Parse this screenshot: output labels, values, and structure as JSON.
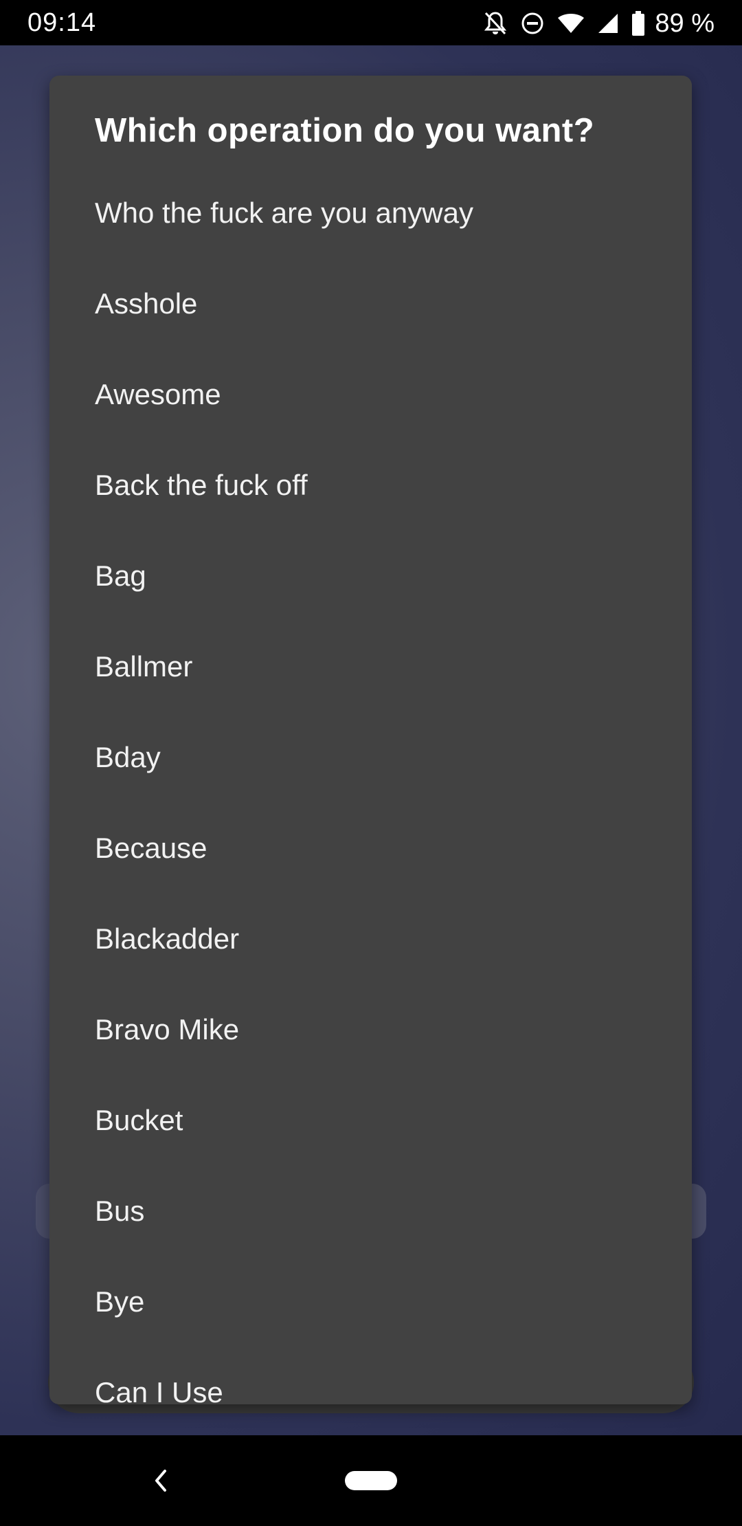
{
  "status_bar": {
    "time": "09:14",
    "battery_percent": "89 %",
    "icons": [
      "notifications-off-icon",
      "do-not-disturb-icon",
      "wifi-icon",
      "cell-signal-icon",
      "battery-icon"
    ]
  },
  "dialog": {
    "title": "Which operation do you want?",
    "options": [
      "Who the fuck are you anyway",
      "Asshole",
      "Awesome",
      "Back the fuck off",
      "Bag",
      "Ballmer",
      "Bday",
      "Because",
      "Blackadder",
      "Bravo Mike",
      "Bucket",
      "Bus",
      "Bye",
      "Can I Use"
    ]
  },
  "nav_bar": {
    "icons": [
      "back-icon",
      "home-pill-icon"
    ]
  },
  "colors": {
    "dialog_bg": "#424242",
    "scrim": "#2e3256",
    "text": "#ffffff"
  }
}
